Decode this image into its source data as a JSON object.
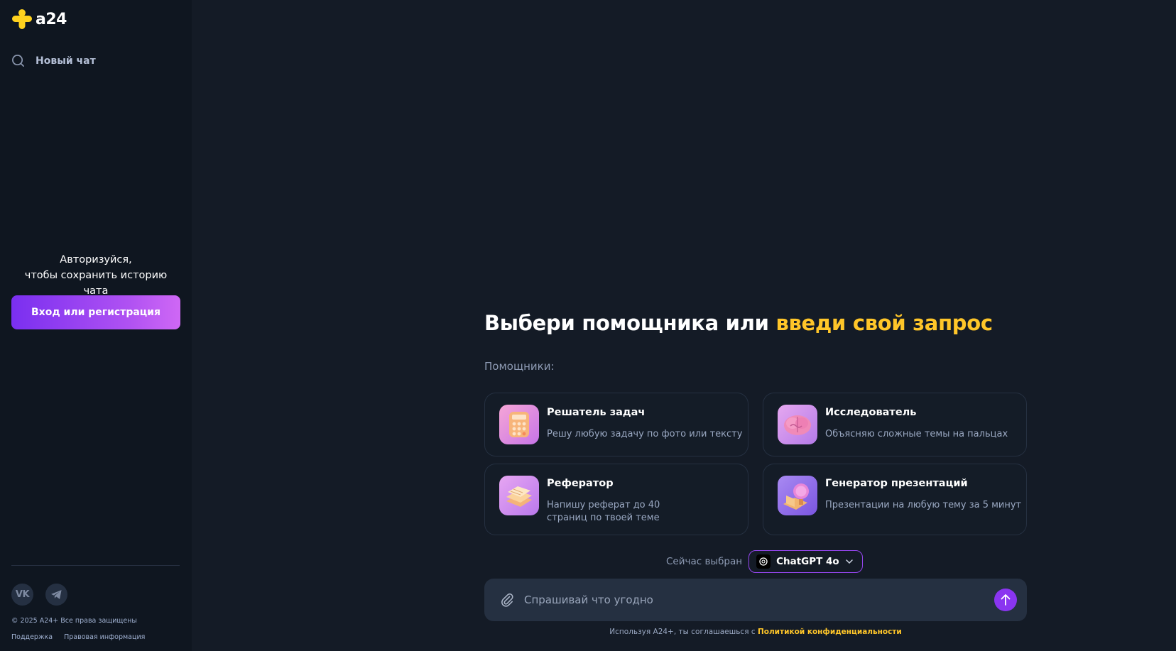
{
  "sidebar": {
    "logo": {
      "text": "a24",
      "icon": "a24-plus-logo-icon",
      "accent_color": "#ffd21e"
    },
    "new_chat": {
      "label": "Новый чат",
      "icon": "search-icon"
    },
    "auth": {
      "line1": "Авторизуйся,",
      "line2": "чтобы сохранить историю чата",
      "button_label": "Вход или регистрация"
    },
    "social": [
      {
        "name": "vk",
        "icon": "vk-icon",
        "glyph": "VK"
      },
      {
        "name": "telegram",
        "icon": "telegram-icon"
      }
    ],
    "copyright": "© 2025 A24+ Все права защищены",
    "footer_links": [
      "Поддержка",
      "Правовая информация"
    ]
  },
  "main": {
    "headline": {
      "part1": "Выбери помощника или ",
      "accent": "введи свой запрос",
      "accent_color": "#ffc629"
    },
    "helpers_label": "Помощники:",
    "cards": [
      {
        "title": "Решатель задач",
        "description": "Решу любую задачу по фото или тексту",
        "icon": "calculator-icon"
      },
      {
        "title": "Исследователь",
        "description": "Объясняю сложные темы на пальцах",
        "icon": "brain-icon"
      },
      {
        "title": "Реферaтор",
        "description": "Напишу реферат до 40 страниц по твоей теме",
        "icon": "paper-stack-icon"
      },
      {
        "title": "Генератор презентаций",
        "description": "Презентации на любую тему за 5 минут",
        "icon": "presentation-icon"
      }
    ],
    "model": {
      "label": "Сейчас выбран",
      "selected": "ChatGPT 4o",
      "icon": "openai-icon",
      "border_color": "#9646f0"
    },
    "input": {
      "placeholder": "Спрашивай что угодно",
      "value": ""
    },
    "consent": {
      "prefix": "Используя A24+, ты соглашаешься с ",
      "link": "Политикой конфиденциальности"
    }
  },
  "colors": {
    "background": "#141b26",
    "sidebar": "#0f1620",
    "primary": "#8a35f0",
    "accent": "#ffc629"
  }
}
